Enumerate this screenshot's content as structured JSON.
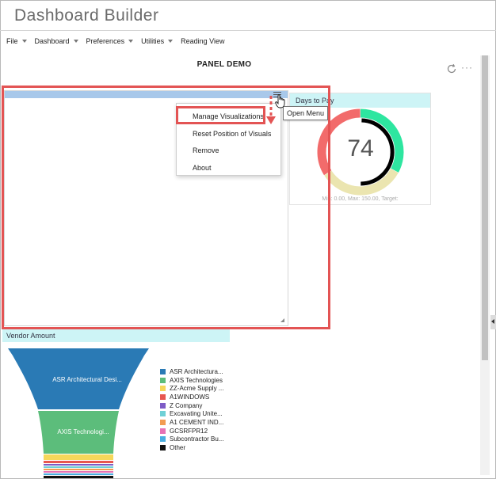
{
  "app": {
    "title": "Dashboard Builder"
  },
  "menu": [
    {
      "label": "File",
      "has_caret": true
    },
    {
      "label": "Dashboard",
      "has_caret": true
    },
    {
      "label": "Preferences",
      "has_caret": true
    },
    {
      "label": "Utilities",
      "has_caret": true
    },
    {
      "label": "Reading View",
      "has_caret": false
    }
  ],
  "page": {
    "title": "PANEL DEMO"
  },
  "toolbar": {
    "refresh_icon": "refresh-icon",
    "more_icon": "more-icon",
    "more_glyph": "···"
  },
  "panel_menu": {
    "icon": "hamburger-icon",
    "tooltip": "Open Menu",
    "items": [
      "Manage Visualizations",
      "Reset Position of Visuals",
      "Remove",
      "About"
    ],
    "highlighted_item": "Manage Visualizations"
  },
  "gauge_panel": {
    "title": "Days to Pay",
    "value": "74",
    "caption": "Min: 0.00, Max: 150.00, Target:",
    "bands": [
      {
        "color": "#f26b6b",
        "fraction": 0.34
      },
      {
        "color": "#ebe5b0",
        "fraction": 0.33
      },
      {
        "color": "#2ee6a0",
        "fraction": 0.33
      }
    ],
    "needle_color": "#000000"
  },
  "vendor_panel": {
    "title": "Vendor Amount",
    "funnel_labels": [
      "ASR Architectural Desi...",
      "AXIS Technologi..."
    ],
    "legend": [
      {
        "label": "ASR Architectura...",
        "color": "#2a7ab5"
      },
      {
        "label": "AXIS Technologies",
        "color": "#5cbd7b"
      },
      {
        "label": "ZZ-Acme Supply ...",
        "color": "#f5d75a"
      },
      {
        "label": "A1WINDOWS",
        "color": "#e8574f"
      },
      {
        "label": "Z Company",
        "color": "#7d5cc6"
      },
      {
        "label": "Excavating Unite...",
        "color": "#6fd0d6"
      },
      {
        "label": "A1 CEMENT IND...",
        "color": "#f29c52"
      },
      {
        "label": "GCSRFPR12",
        "color": "#e772b5"
      },
      {
        "label": "Subcontractor Bu...",
        "color": "#4aaee0"
      },
      {
        "label": "Other",
        "color": "#111111"
      }
    ]
  },
  "colors": {
    "highlight": "#e35454",
    "panel_header": "#cdf4f6",
    "selected_panel_header": "#a8c8ea"
  }
}
